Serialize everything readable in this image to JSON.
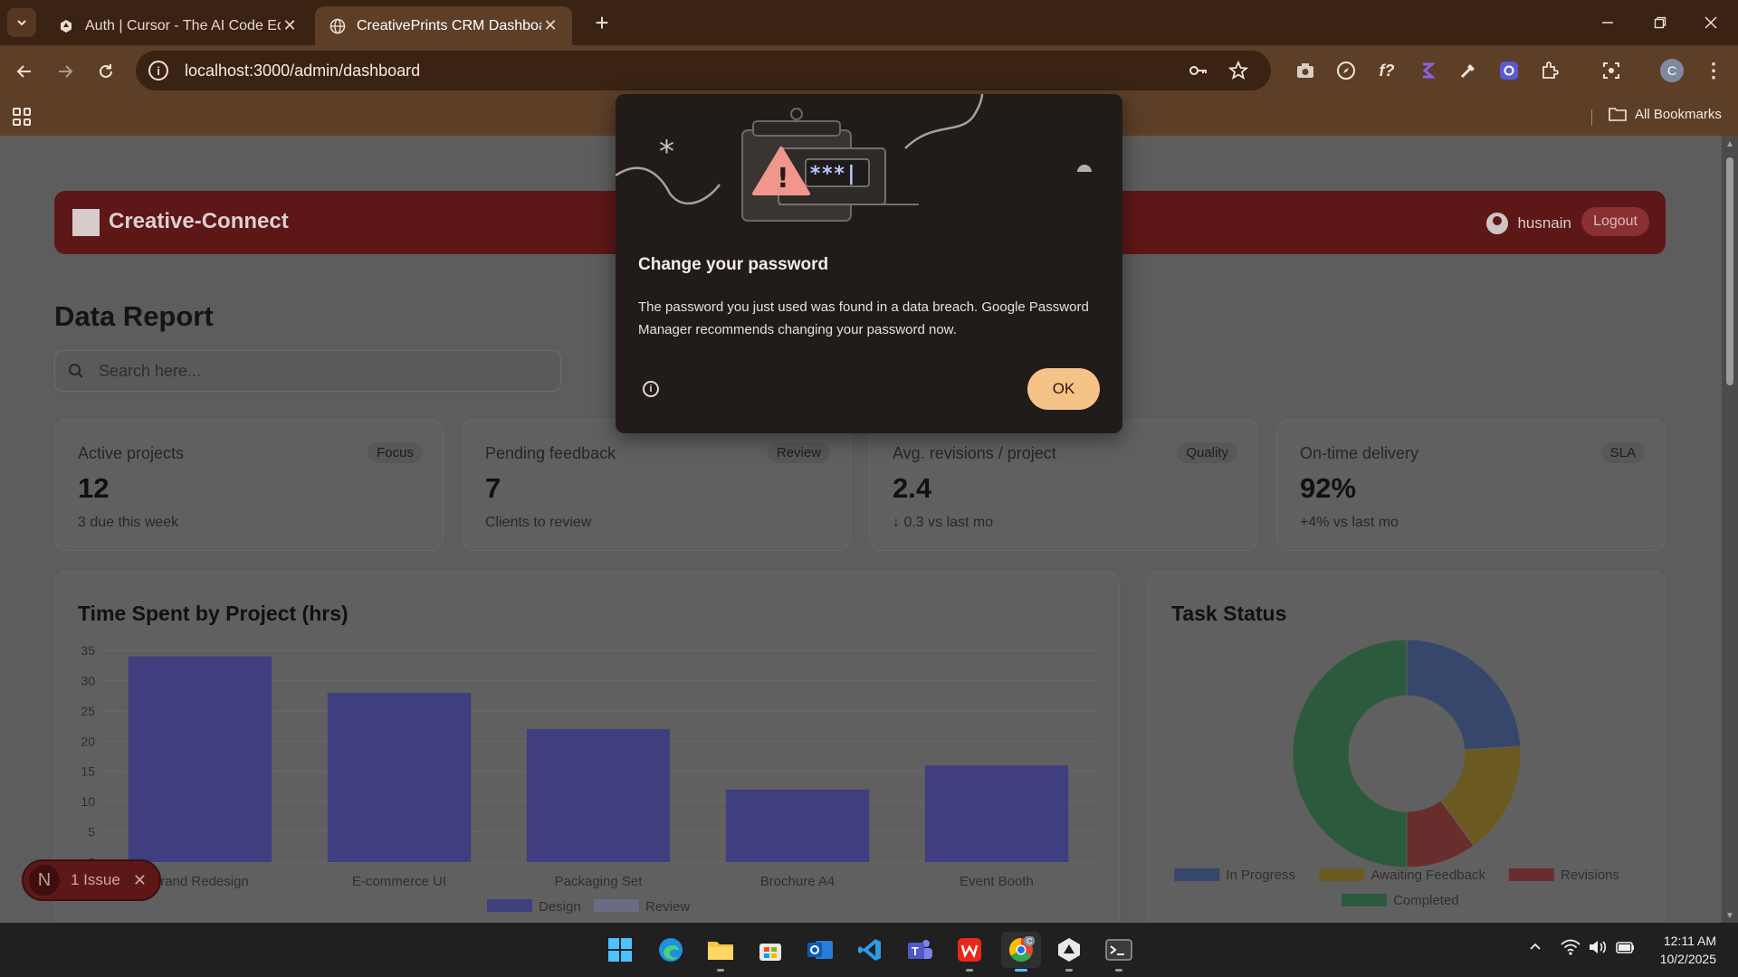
{
  "browser": {
    "tabs": [
      {
        "title": "Auth | Cursor - The AI Code Editor",
        "active": false
      },
      {
        "title": "CreativePrints CRM Dashboard",
        "active": true
      }
    ],
    "url": "localhost:3000/admin/dashboard",
    "profile_initial": "C",
    "bookmarks_label": "All Bookmarks"
  },
  "app": {
    "brand": "Creative-Connect",
    "user_name": "husnain",
    "logout_label": "Logout",
    "page_title": "Data Report",
    "search_placeholder": "Search here..."
  },
  "stats": [
    {
      "label": "Active projects",
      "tag": "Focus",
      "value": "12",
      "sub": "3 due this week"
    },
    {
      "label": "Pending feedback",
      "tag": "Review",
      "value": "7",
      "sub": "Clients to review"
    },
    {
      "label": "Avg. revisions / project",
      "tag": "Quality",
      "value": "2.4",
      "sub": "↓ 0.3 vs last mo"
    },
    {
      "label": "On-time delivery",
      "tag": "SLA",
      "value": "92%",
      "sub": "+4% vs last mo"
    }
  ],
  "panels": {
    "bar_title": "Time Spent by Project (hrs)",
    "donut_title": "Task Status"
  },
  "chart_data": [
    {
      "type": "bar",
      "title": "Time Spent by Project (hrs)",
      "categories": [
        "Brand Redesign",
        "E-commerce UI",
        "Packaging Set",
        "Brochure A4",
        "Event Booth"
      ],
      "series": [
        {
          "name": "Design",
          "values": [
            34,
            28,
            22,
            12,
            16
          ],
          "color": "#3f3f80"
        },
        {
          "name": "Review",
          "values": [
            0,
            0,
            0,
            0,
            0
          ],
          "color": "#6b6b84"
        }
      ],
      "yticks": [
        0,
        5,
        10,
        15,
        20,
        25,
        30,
        35
      ],
      "ylim": [
        0,
        35
      ],
      "legend_position": "bottom",
      "grid": true
    },
    {
      "type": "pie",
      "title": "Task Status",
      "donut": true,
      "labels": [
        "In Progress",
        "Awaiting Feedback",
        "Revisions",
        "Completed"
      ],
      "values": [
        24,
        16,
        10,
        50
      ],
      "colors": [
        "#36476b",
        "#6b5a1f",
        "#6a2d2d",
        "#2c5a3c"
      ],
      "legend_position": "bottom"
    }
  ],
  "issue_badge": {
    "initial": "N",
    "label": "1 Issue"
  },
  "dialog": {
    "title": "Change your password",
    "body": "The password you just used was found in a data breach. Google Password Manager recommends changing your password now.",
    "ok_label": "OK",
    "masked": "***|"
  },
  "clock": {
    "time": "12:11 AM",
    "date": "10/2/2025"
  },
  "colors": {
    "accent": "#5e1717",
    "ok_button": "#f5c287",
    "chrome_frame": "#3a2313"
  }
}
